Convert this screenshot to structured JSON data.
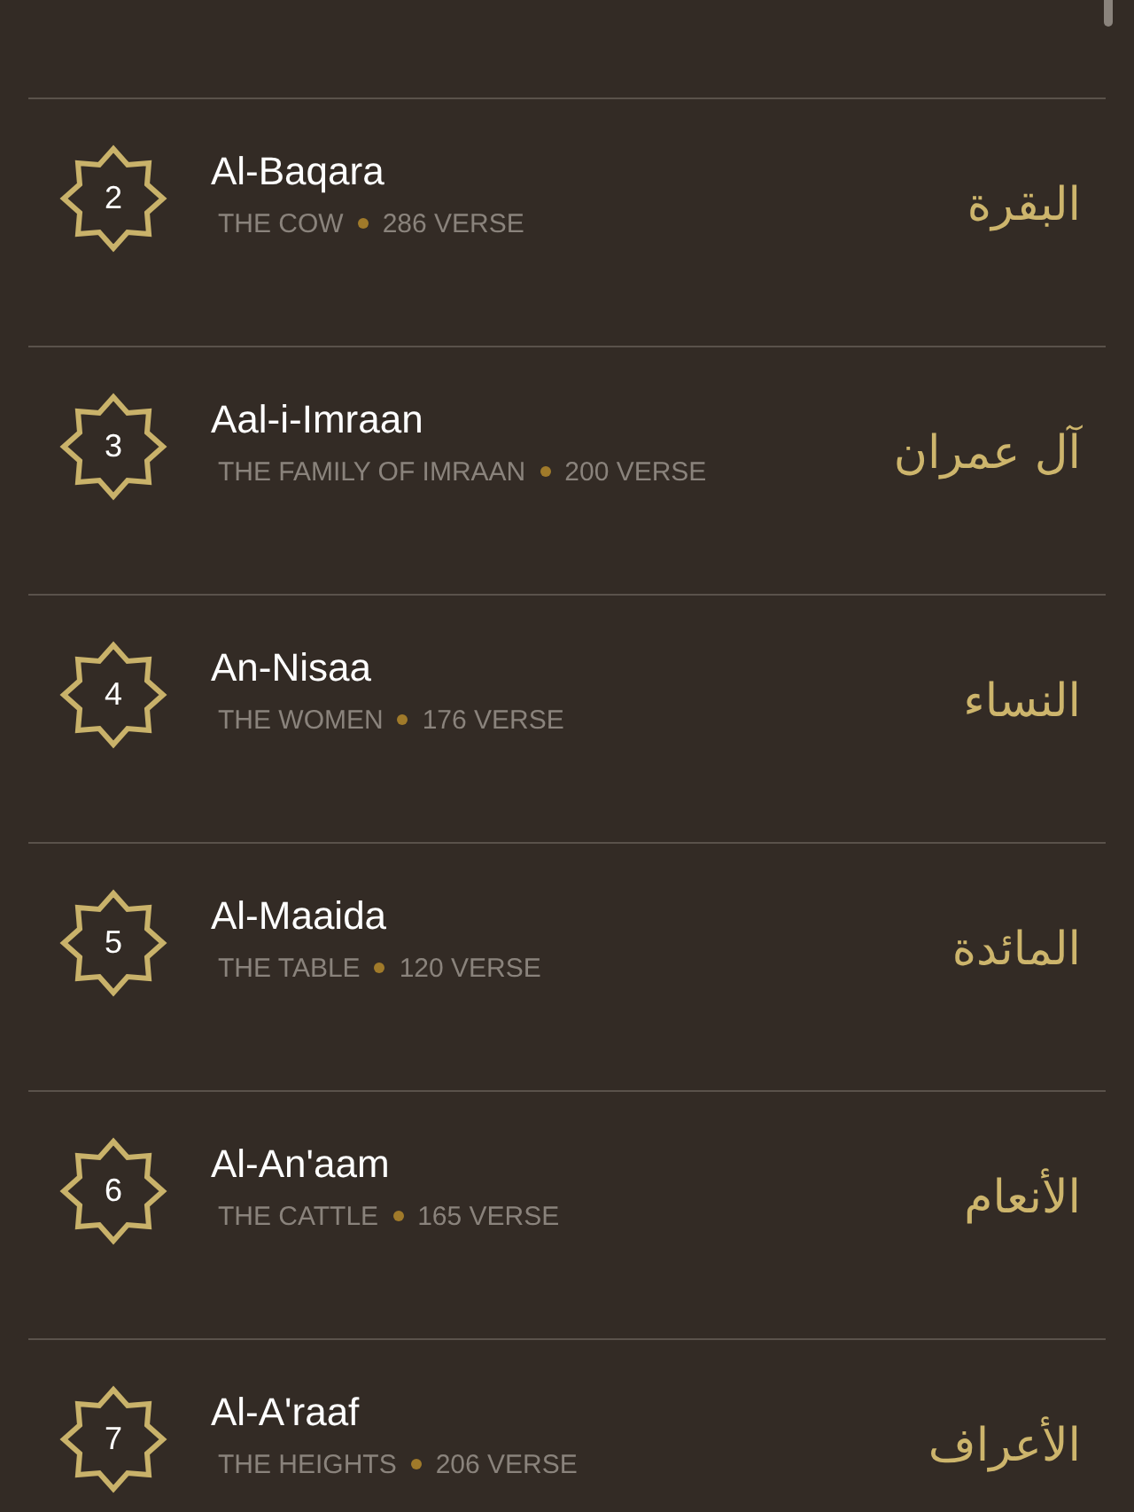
{
  "surahs": [
    {
      "number": "2",
      "name": "Al-Baqara",
      "meaning": "THE COW",
      "verses": "286 VERSE",
      "arabic": "البقرة"
    },
    {
      "number": "3",
      "name": "Aal-i-Imraan",
      "meaning": "THE FAMILY OF IMRAAN",
      "verses": "200 VERSE",
      "arabic": "آل عمران"
    },
    {
      "number": "4",
      "name": "An-Nisaa",
      "meaning": "THE WOMEN",
      "verses": "176 VERSE",
      "arabic": "النساء"
    },
    {
      "number": "5",
      "name": "Al-Maaida",
      "meaning": "THE TABLE",
      "verses": "120 VERSE",
      "arabic": "المائدة"
    },
    {
      "number": "6",
      "name": "Al-An'aam",
      "meaning": "THE CATTLE",
      "verses": "165 VERSE",
      "arabic": "الأنعام"
    },
    {
      "number": "7",
      "name": "Al-A'raaf",
      "meaning": "THE HEIGHTS",
      "verses": "206 VERSE",
      "arabic": "الأعراف"
    }
  ]
}
